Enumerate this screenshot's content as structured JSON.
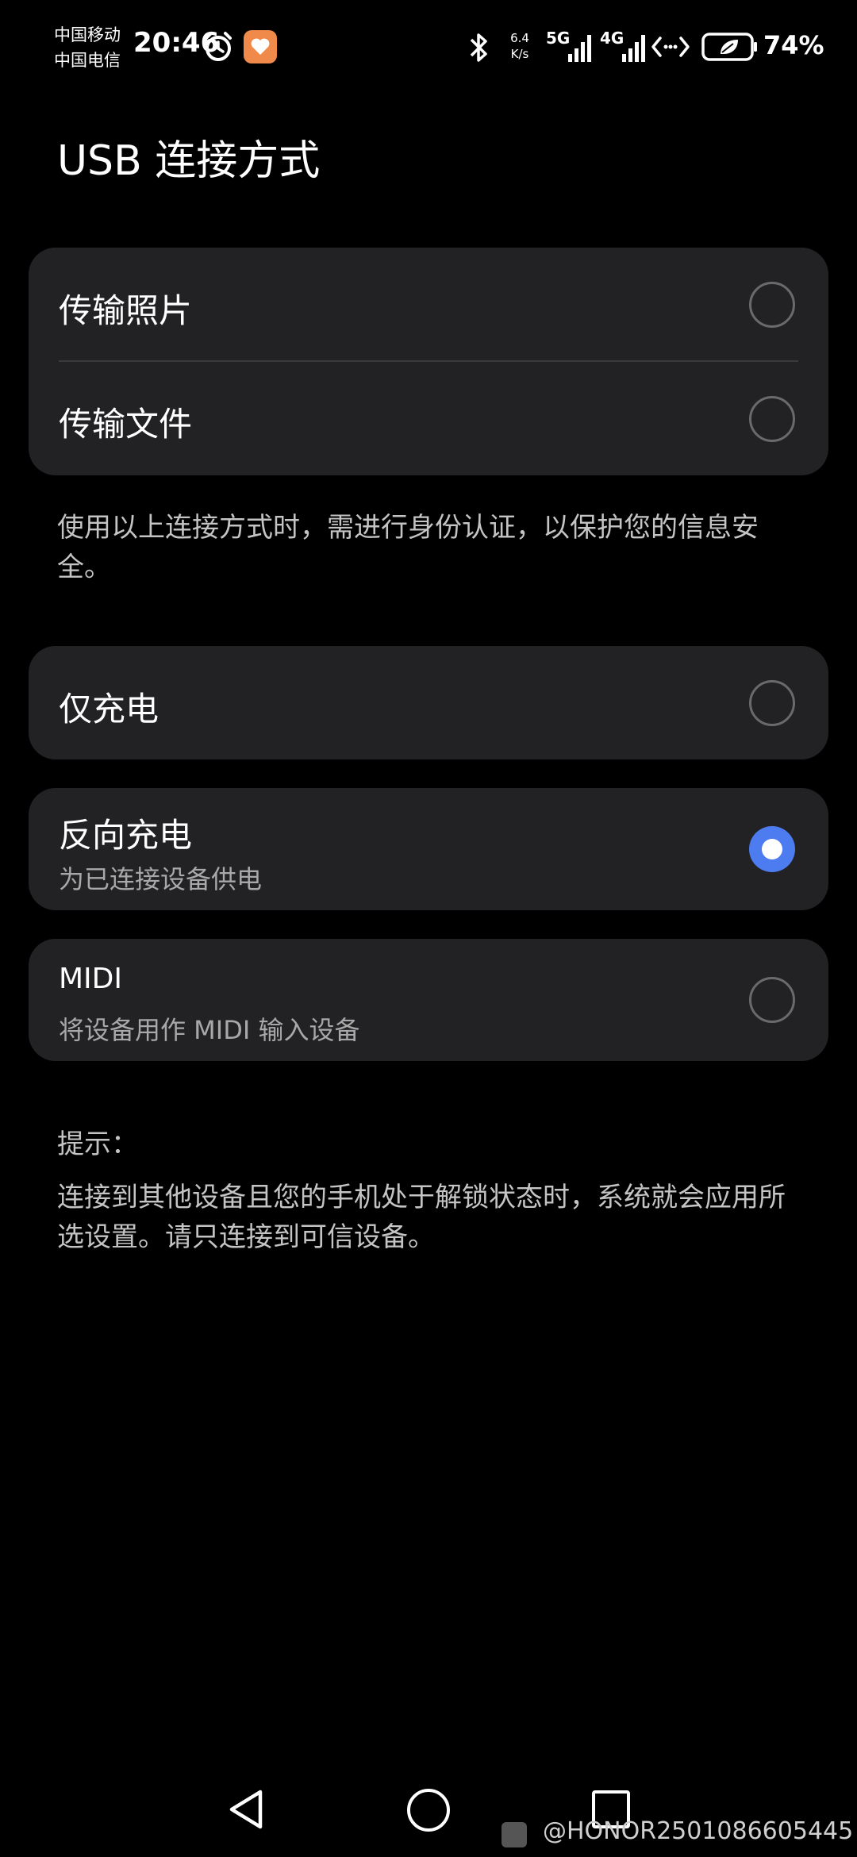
{
  "status_bar": {
    "carrier_1": "中国移动",
    "carrier_2": "中国电信",
    "time": "20:46",
    "net_speed_value": "6.4",
    "net_speed_unit": "K/s",
    "signal_1_label": "5G",
    "signal_2_label": "4G",
    "battery_percent": "74%",
    "icons": [
      "alarm-icon",
      "app-notification-icon",
      "bluetooth-icon",
      "signal-icon",
      "data-transfer-icon",
      "battery-saver-icon"
    ]
  },
  "page": {
    "title": "USB 连接方式"
  },
  "group_transfer": {
    "options": [
      {
        "label": "传输照片",
        "selected": false
      },
      {
        "label": "传输文件",
        "selected": false
      }
    ],
    "note": "使用以上连接方式时，需进行身份认证，以保护您的信息安全。"
  },
  "charge_only": {
    "label": "仅充电",
    "selected": false
  },
  "reverse_charge": {
    "label": "反向充电",
    "subtitle": "为已连接设备供电",
    "selected": true
  },
  "midi": {
    "label": "MIDI",
    "subtitle": "将设备用作 MIDI 输入设备",
    "selected": false
  },
  "tip": {
    "label": "提示：",
    "text": "连接到其他设备且您的手机处于解锁状态时，系统就会应用所选设置。请只连接到可信设备。"
  },
  "watermark": {
    "text": "@HONOR2501086605445"
  },
  "colors": {
    "background": "#000000",
    "card": "#222224",
    "accent": "#4d7cf0",
    "text_primary": "#ffffff",
    "text_secondary": "#a8a8a8"
  }
}
